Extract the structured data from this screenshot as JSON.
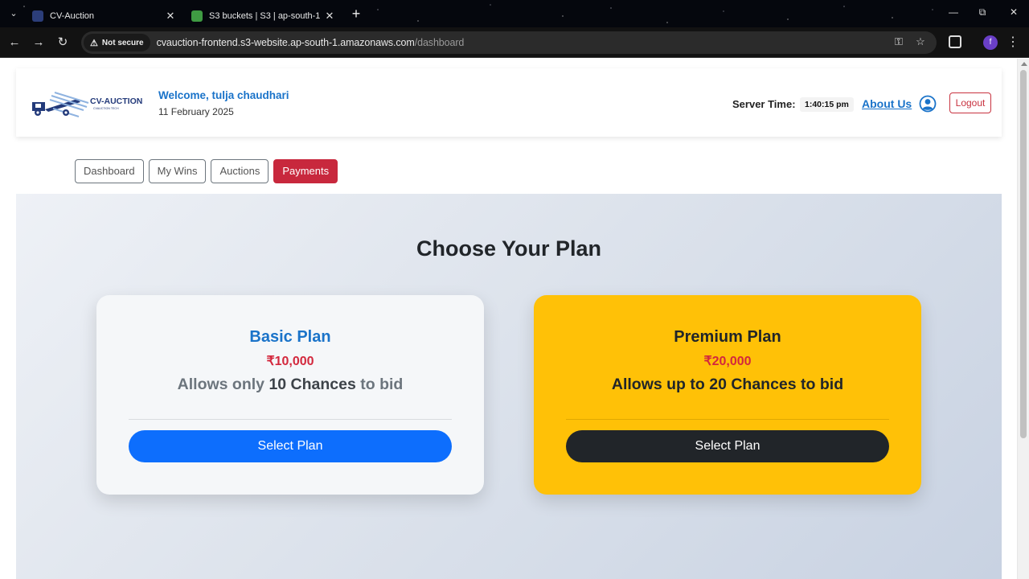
{
  "browser": {
    "tabs": [
      {
        "title": "CV-Auction",
        "favicon": "cv-auction-favicon"
      },
      {
        "title": "S3 buckets | S3 | ap-south-1",
        "favicon": "aws-s3-favicon"
      }
    ],
    "security_label": "Not secure",
    "url_host": "cvauction-frontend.s3-website.ap-south-1.amazonaws.com",
    "url_path": "/dashboard",
    "profile_initial": "f"
  },
  "header": {
    "logo_text": "CV-AUCTION",
    "logo_subtext": "CVAUCTION TECH",
    "welcome": "Welcome, tulja chaudhari",
    "date": "11 February 2025",
    "server_time_label": "Server Time:",
    "server_time": "1:40:15 pm",
    "about_label": "About Us",
    "logout_label": "Logout"
  },
  "nav": {
    "tabs": [
      "Dashboard",
      "My Wins",
      "Auctions",
      "Payments"
    ],
    "active": "Payments"
  },
  "plans": {
    "title": "Choose Your Plan",
    "items": [
      {
        "name": "Basic Plan",
        "price": "₹10,000",
        "desc_prefix": "Allows only ",
        "desc_strong": "10 Chances",
        "desc_suffix": " to bid",
        "button": "Select Plan"
      },
      {
        "name": "Premium Plan",
        "price": "₹20,000",
        "desc_prefix": "Allows up to ",
        "desc_strong": "20 Chances",
        "desc_suffix": " to bid",
        "button": "Select Plan"
      }
    ]
  },
  "colors": {
    "brand_blue": "#1a73c9",
    "danger_red": "#c8283d",
    "primary_button": "#0d6efd",
    "premium_yellow": "#ffc107",
    "dark_button": "#212529"
  }
}
